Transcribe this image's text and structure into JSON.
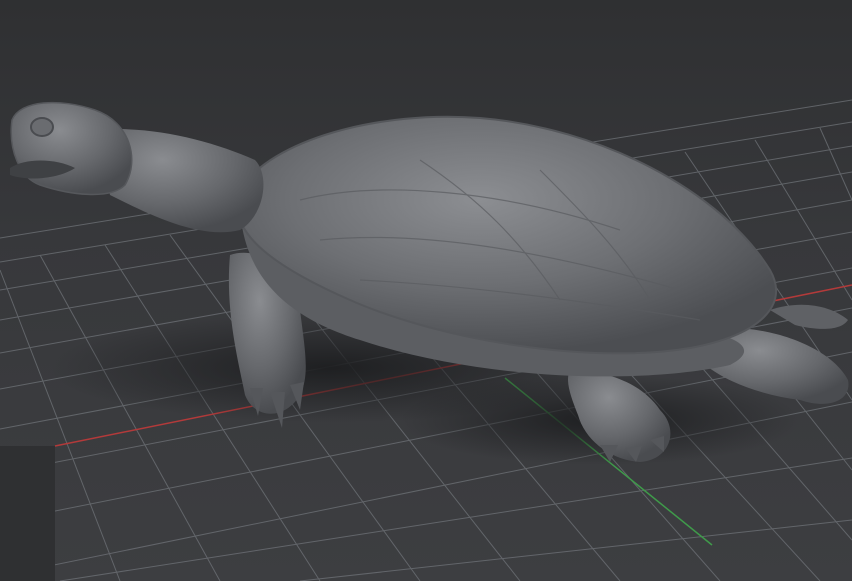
{
  "viewport": {
    "scene_object": "turtle-mesh",
    "background_color": "#37383b",
    "grid_color": "#6f7378",
    "x_axis_color": "#b33a3a",
    "y_axis_color": "#3f9a4a",
    "mesh_color": "#7a7c80"
  }
}
